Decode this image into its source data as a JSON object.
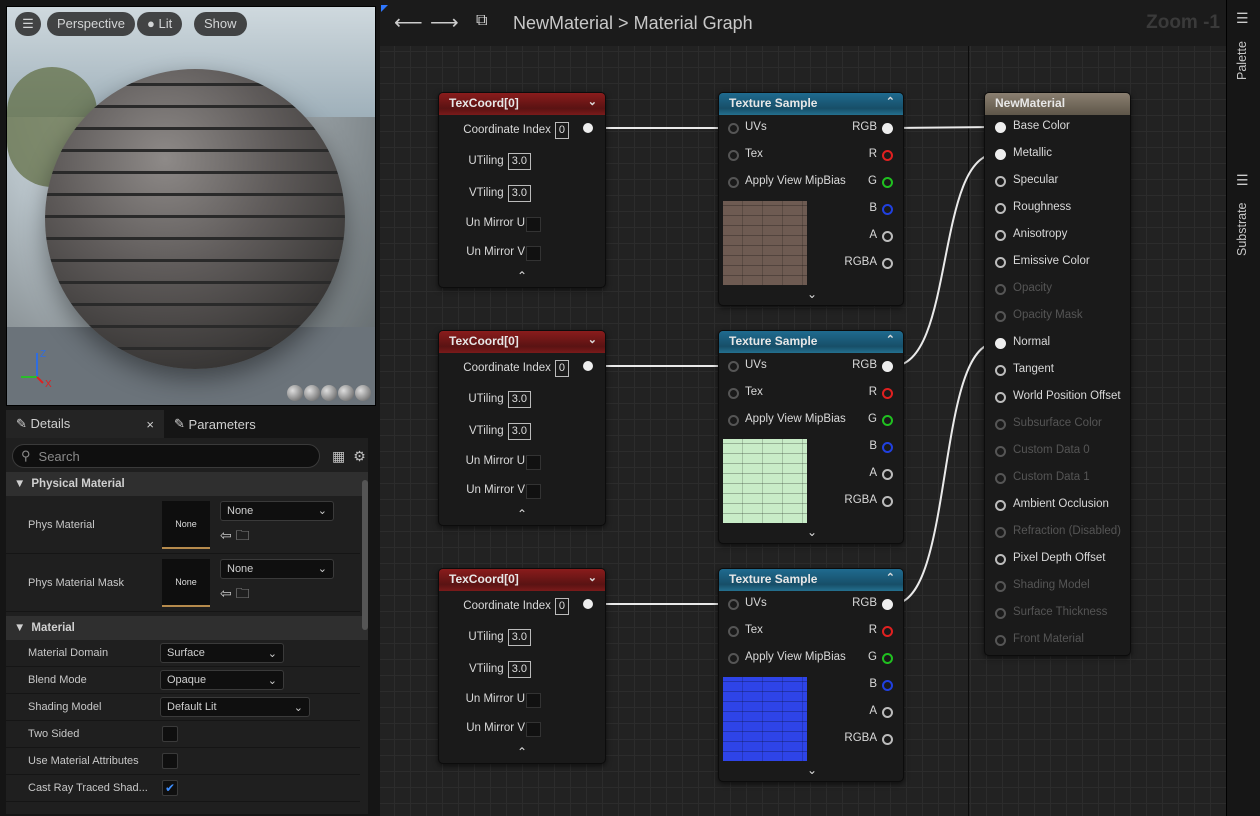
{
  "viewport": {
    "buttons": [
      "Perspective",
      "Lit",
      "Show"
    ]
  },
  "details": {
    "tabs": [
      {
        "label": "Details",
        "close": "×"
      },
      {
        "label": "Parameters"
      }
    ],
    "search_placeholder": "Search",
    "sections": {
      "physical": "Physical Material",
      "material": "Material"
    },
    "phys_rows": [
      {
        "label": "Phys Material",
        "thumb": "None",
        "value": "None"
      },
      {
        "label": "Phys Material Mask",
        "thumb": "None",
        "value": "None"
      }
    ],
    "mat_rows": [
      {
        "label": "Material Domain",
        "value": "Surface"
      },
      {
        "label": "Blend Mode",
        "value": "Opaque"
      },
      {
        "label": "Shading Model",
        "value": "Default Lit"
      }
    ],
    "check_rows": [
      {
        "label": "Two Sided",
        "checked": false
      },
      {
        "label": "Use Material Attributes",
        "checked": false
      },
      {
        "label": "Cast Ray Traced Shad...",
        "checked": true
      }
    ]
  },
  "graph": {
    "breadcrumb": {
      "asset": "NewMaterial",
      "separator": ">",
      "page": "Material Graph"
    },
    "zoom": "Zoom -1",
    "texcoord": {
      "title": "TexCoord[0]",
      "coordinate_index_label": "Coordinate Index",
      "coordinate_index": "0",
      "utiling_label": "UTiling",
      "utiling": "3.0",
      "vtiling_label": "VTiling",
      "vtiling": "3.0",
      "unmirror_u": "Un Mirror U",
      "unmirror_v": "Un Mirror V"
    },
    "texsample": {
      "title": "Texture Sample",
      "inputs": [
        "UVs",
        "Tex",
        "Apply View MipBias"
      ],
      "outputs": [
        "RGB",
        "R",
        "G",
        "B",
        "A",
        "RGBA"
      ]
    },
    "result": {
      "title": "NewMaterial",
      "pins": [
        {
          "label": "Base Color",
          "state": "connected"
        },
        {
          "label": "Metallic",
          "state": "connected"
        },
        {
          "label": "Specular",
          "state": "on"
        },
        {
          "label": "Roughness",
          "state": "on"
        },
        {
          "label": "Anisotropy",
          "state": "on"
        },
        {
          "label": "Emissive Color",
          "state": "on"
        },
        {
          "label": "Opacity",
          "state": "off"
        },
        {
          "label": "Opacity Mask",
          "state": "off"
        },
        {
          "label": "Normal",
          "state": "connected"
        },
        {
          "label": "Tangent",
          "state": "on"
        },
        {
          "label": "World Position Offset",
          "state": "on"
        },
        {
          "label": "Subsurface Color",
          "state": "off"
        },
        {
          "label": "Custom Data 0",
          "state": "off"
        },
        {
          "label": "Custom Data 1",
          "state": "off"
        },
        {
          "label": "Ambient Occlusion",
          "state": "on"
        },
        {
          "label": "Refraction (Disabled)",
          "state": "off"
        },
        {
          "label": "Pixel Depth Offset",
          "state": "on"
        },
        {
          "label": "Shading Model",
          "state": "off"
        },
        {
          "label": "Surface Thickness",
          "state": "off"
        },
        {
          "label": "Front Material",
          "state": "off"
        }
      ]
    },
    "swatch_colors": [
      "#6e5b52",
      "#c8ecc7",
      "#2e44e8"
    ]
  },
  "rightbar": {
    "palette": "Palette",
    "substrate": "Substrate"
  },
  "colors": {
    "r": "#e02020",
    "g": "#20c020",
    "b": "#2040e0"
  }
}
